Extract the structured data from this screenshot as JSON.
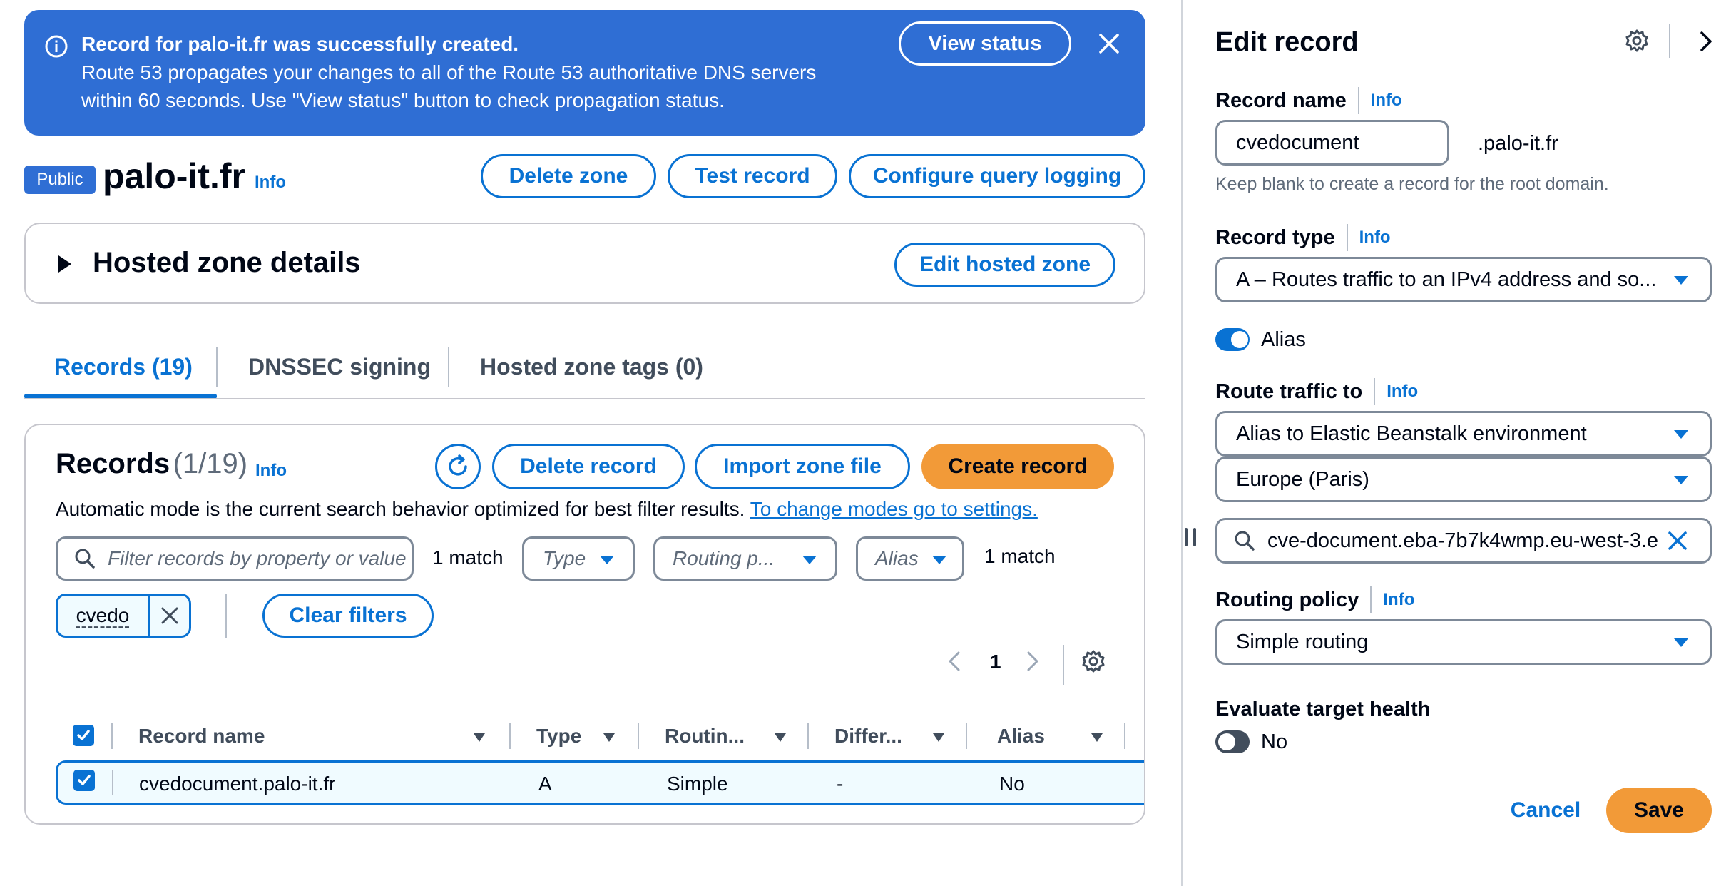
{
  "flash": {
    "title": "Record for palo-it.fr was successfully created.",
    "line1": "Route 53 propagates your changes to all of the Route 53 authoritative DNS servers",
    "line2": "within 60 seconds. Use \"View status\" button to check propagation status.",
    "view_status": "View status"
  },
  "header": {
    "badge": "Public",
    "zone_name": "palo-it.fr",
    "info": "Info",
    "delete_zone": "Delete zone",
    "test_record": "Test record",
    "configure_logging": "Configure query logging"
  },
  "details": {
    "title": "Hosted zone details",
    "edit": "Edit hosted zone"
  },
  "tabs": [
    {
      "label": "Records (19)",
      "active": true
    },
    {
      "label": "DNSSEC signing",
      "active": false
    },
    {
      "label": "Hosted zone tags (0)",
      "active": false
    }
  ],
  "records": {
    "title": "Records",
    "count": "(1/19)",
    "info": "Info",
    "delete": "Delete record",
    "import": "Import zone file",
    "create": "Create record",
    "mode_text": "Automatic mode is the current search behavior optimized for best filter results.",
    "mode_link": "To change modes go to settings.",
    "search_placeholder": "Filter records by property or value",
    "match1": "1 match",
    "type_filter": "Type",
    "routing_filter": "Routing p...",
    "alias_filter": "Alias",
    "match2": "1 match",
    "token": "cvedo",
    "clear_filters": "Clear filters",
    "page": "1",
    "columns": [
      "Record name",
      "Type",
      "Routin...",
      "Differ...",
      "Alias"
    ],
    "rows": [
      {
        "name": "cvedocument.palo-it.fr",
        "type": "A",
        "routing": "Simple",
        "differ": "-",
        "alias": "No"
      }
    ]
  },
  "panel": {
    "title": "Edit record",
    "record_name_label": "Record name",
    "info": "Info",
    "record_name_value": "cvedocument",
    "domain_suffix": ".palo-it.fr",
    "record_name_hint": "Keep blank to create a record for the root domain.",
    "record_type_label": "Record type",
    "record_type_value": "A – Routes traffic to an IPv4 address and so...",
    "alias_label": "Alias",
    "route_label": "Route traffic to",
    "route_value": "Alias to Elastic Beanstalk environment",
    "region_value": "Europe (Paris)",
    "endpoint_value": "cve-document.eba-7b7k4wmp.eu-west-3.e",
    "routing_policy_label": "Routing policy",
    "routing_policy_value": "Simple routing",
    "eval_health_label": "Evaluate target health",
    "eval_health_value": "No",
    "cancel": "Cancel",
    "save": "Save"
  },
  "colors": {
    "flash_bg": "#2f6ed4",
    "primary": "#0972d3",
    "accent": "#f29a38"
  }
}
